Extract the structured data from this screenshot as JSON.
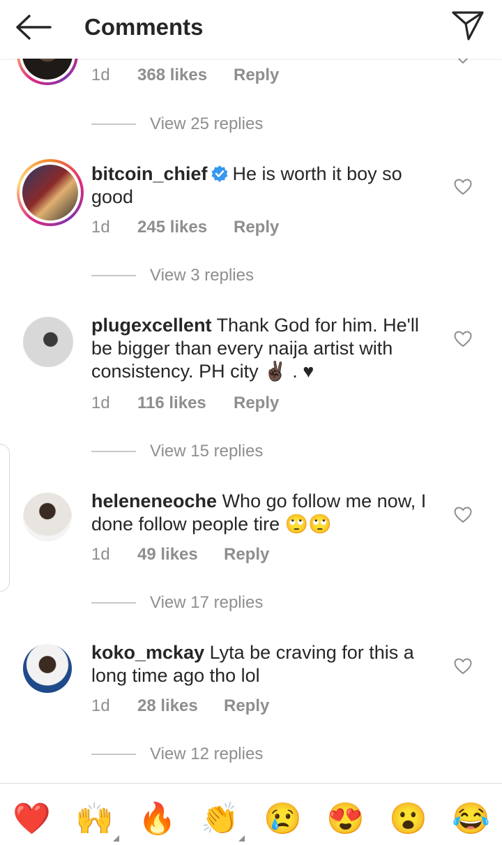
{
  "header": {
    "title": "Comments"
  },
  "top_comment": {
    "time": "1d",
    "likes": "368 likes",
    "reply": "Reply",
    "view_replies": "View 25 replies"
  },
  "comments": [
    {
      "username": "bitcoin_chief",
      "verified": true,
      "text": "He is worth it boy so good",
      "time": "1d",
      "likes": "245 likes",
      "reply": "Reply",
      "view_replies": "View 3 replies"
    },
    {
      "username": "plugexcellent",
      "text": "Thank God for him. He'll be bigger than every naija artist with consistency. PH city ✌🏿 . ♥",
      "time": "1d",
      "likes": "116 likes",
      "reply": "Reply",
      "view_replies": "View 15 replies"
    },
    {
      "username": "heleneneoche",
      "text": "Who go follow me now, I done follow people tire 🙄🙄",
      "time": "1d",
      "likes": "49 likes",
      "reply": "Reply",
      "view_replies": "View 17 replies"
    },
    {
      "username": "koko_mckay",
      "text": "Lyta be craving for this a long time ago tho lol",
      "time": "1d",
      "likes": "28 likes",
      "reply": "Reply",
      "view_replies": "View 12 replies"
    }
  ],
  "emoji_bar": [
    "❤️",
    "🙌",
    "🔥",
    "👏",
    "😢",
    "😍",
    "😮",
    "😂"
  ],
  "colors": {
    "text": "#262626",
    "secondary": "#8e8e8e",
    "verified": "#3897f0",
    "like_red": "#ed4956"
  }
}
